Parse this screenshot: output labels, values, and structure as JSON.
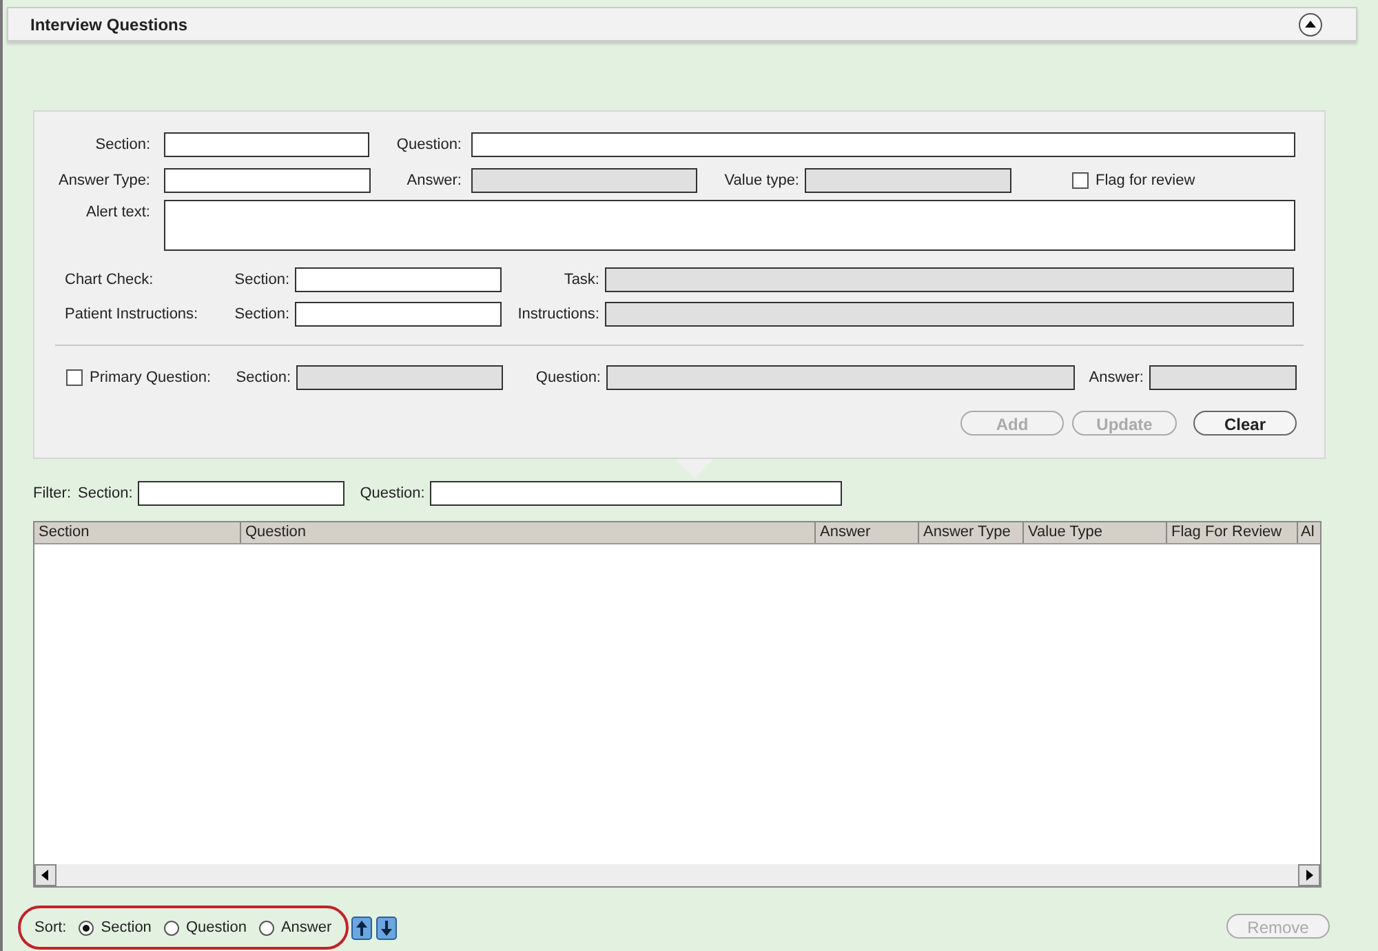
{
  "panel": {
    "title": "Interview Questions",
    "expanded": true
  },
  "form": {
    "section": {
      "label": "Section:",
      "disabled": false
    },
    "question": {
      "label": "Question:",
      "disabled": false
    },
    "answer_type": {
      "label": "Answer Type:",
      "disabled": false
    },
    "answer": {
      "label": "Answer:",
      "disabled": true
    },
    "value_type": {
      "label": "Value type:",
      "disabled": true
    },
    "flag_for_review": {
      "label": "Flag for review",
      "checked": false
    },
    "alert_text": {
      "label": "Alert text:"
    },
    "chart_check": {
      "label": "Chart Check:",
      "section": {
        "label": "Section:",
        "disabled": false
      },
      "task": {
        "label": "Task:",
        "disabled": true
      }
    },
    "patient_instructions": {
      "label": "Patient Instructions:",
      "section": {
        "label": "Section:",
        "disabled": false
      },
      "instructions": {
        "label": "Instructions:",
        "disabled": true
      }
    },
    "primary_question": {
      "label": "Primary Question:",
      "checked": false,
      "section": {
        "label": "Section:",
        "disabled": true
      },
      "question": {
        "label": "Question:",
        "disabled": true
      },
      "answer": {
        "label": "Answer:",
        "disabled": true
      }
    },
    "buttons": [
      {
        "label": "Add",
        "disabled": true
      },
      {
        "label": "Update",
        "disabled": true
      },
      {
        "label": "Clear",
        "disabled": false
      }
    ]
  },
  "filter": {
    "label": "Filter:",
    "section": {
      "label": "Section:"
    },
    "question": {
      "label": "Question:"
    }
  },
  "table": {
    "columns": [
      "Section",
      "Question",
      "Answer",
      "Answer Type",
      "Value Type",
      "Flag For Review",
      "Al"
    ]
  },
  "sort": {
    "label": "Sort:",
    "options": [
      {
        "label": "Section",
        "selected": true
      },
      {
        "label": "Question",
        "selected": false
      },
      {
        "label": "Answer",
        "selected": false
      }
    ]
  },
  "remove_button": {
    "label": "Remove",
    "disabled": true
  }
}
